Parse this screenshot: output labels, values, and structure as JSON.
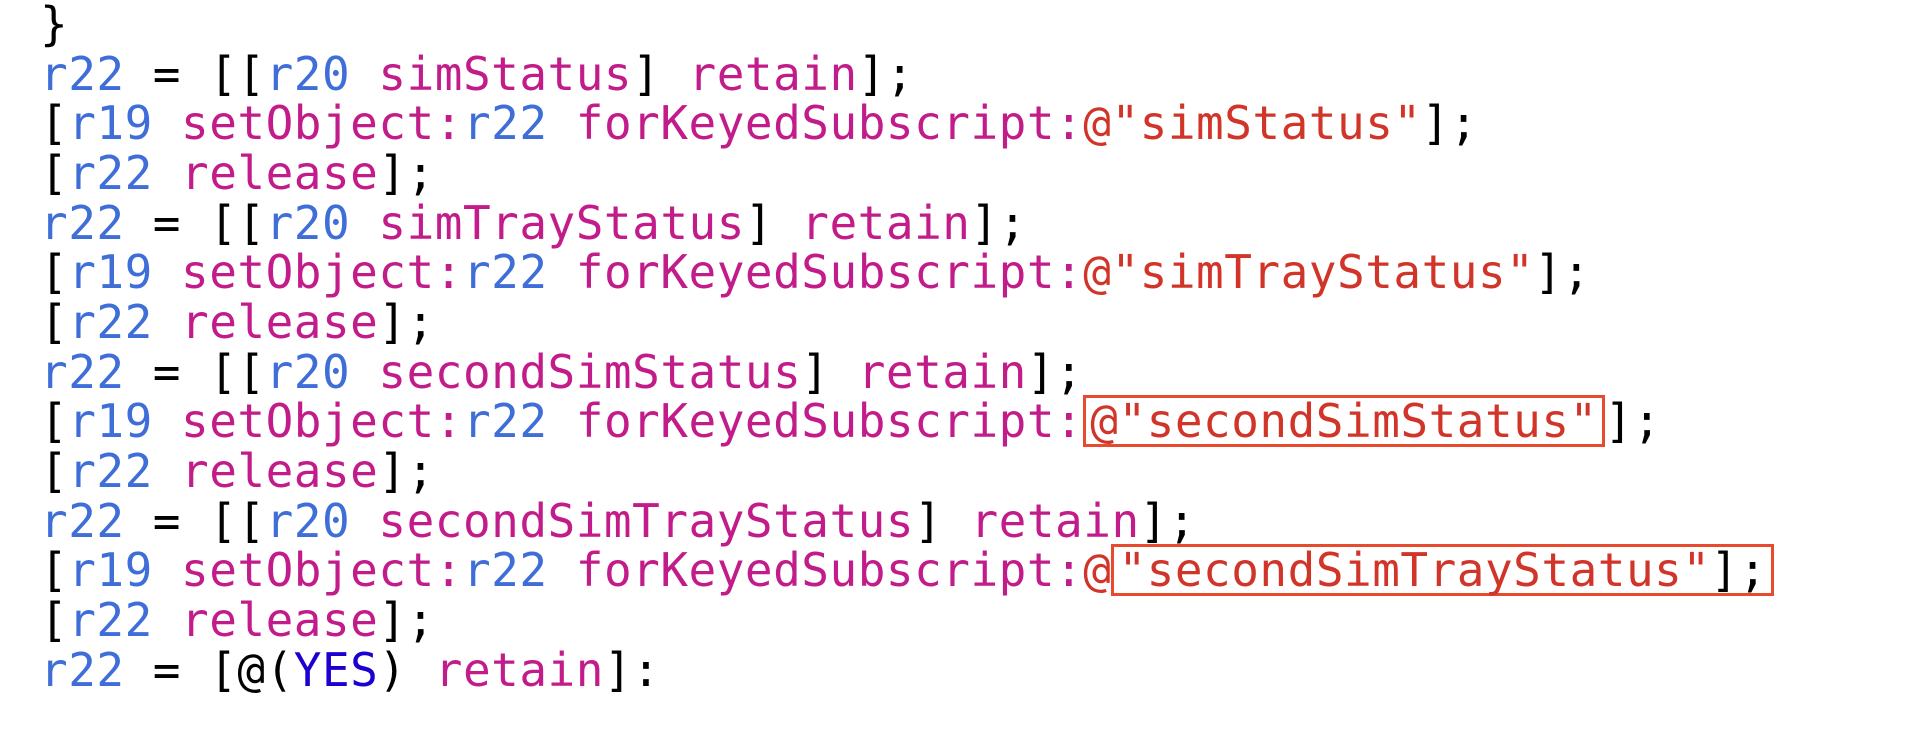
{
  "code": {
    "registers": {
      "r19": "r19",
      "r20": "r20",
      "r22": "r22"
    },
    "selectors": {
      "simStatus": "simStatus",
      "simTrayStatus": "simTrayStatus",
      "secondSimStatus": "secondSimStatus",
      "secondSimTrayStatus": "secondSimTrayStatus",
      "retain": "retain",
      "release": "release",
      "setObject": "setObject:",
      "forKeyedSubscript": "forKeyedSubscript:"
    },
    "strings": {
      "simStatus": "@\"simStatus\"",
      "simTrayStatus": "@\"simTrayStatus\"",
      "secondSimStatus": "@\"secondSimStatus\"",
      "secondSimTrayStatus": "\"secondSimTrayStatus\"",
      "at": "@"
    },
    "literals": {
      "yes": "YES"
    },
    "punct": {
      "closeBrace": "}",
      "eq": " = ",
      "lbr2": "[[",
      "rbr": "]",
      "lbr": "[",
      "semi": ";",
      "space": " ",
      "rbr_semi": "];",
      "rbr2_semi": "]];",
      "rbr_space": "] ",
      "atParen": "@(",
      "rParen": ")",
      "rbr_colon": "]:"
    }
  }
}
